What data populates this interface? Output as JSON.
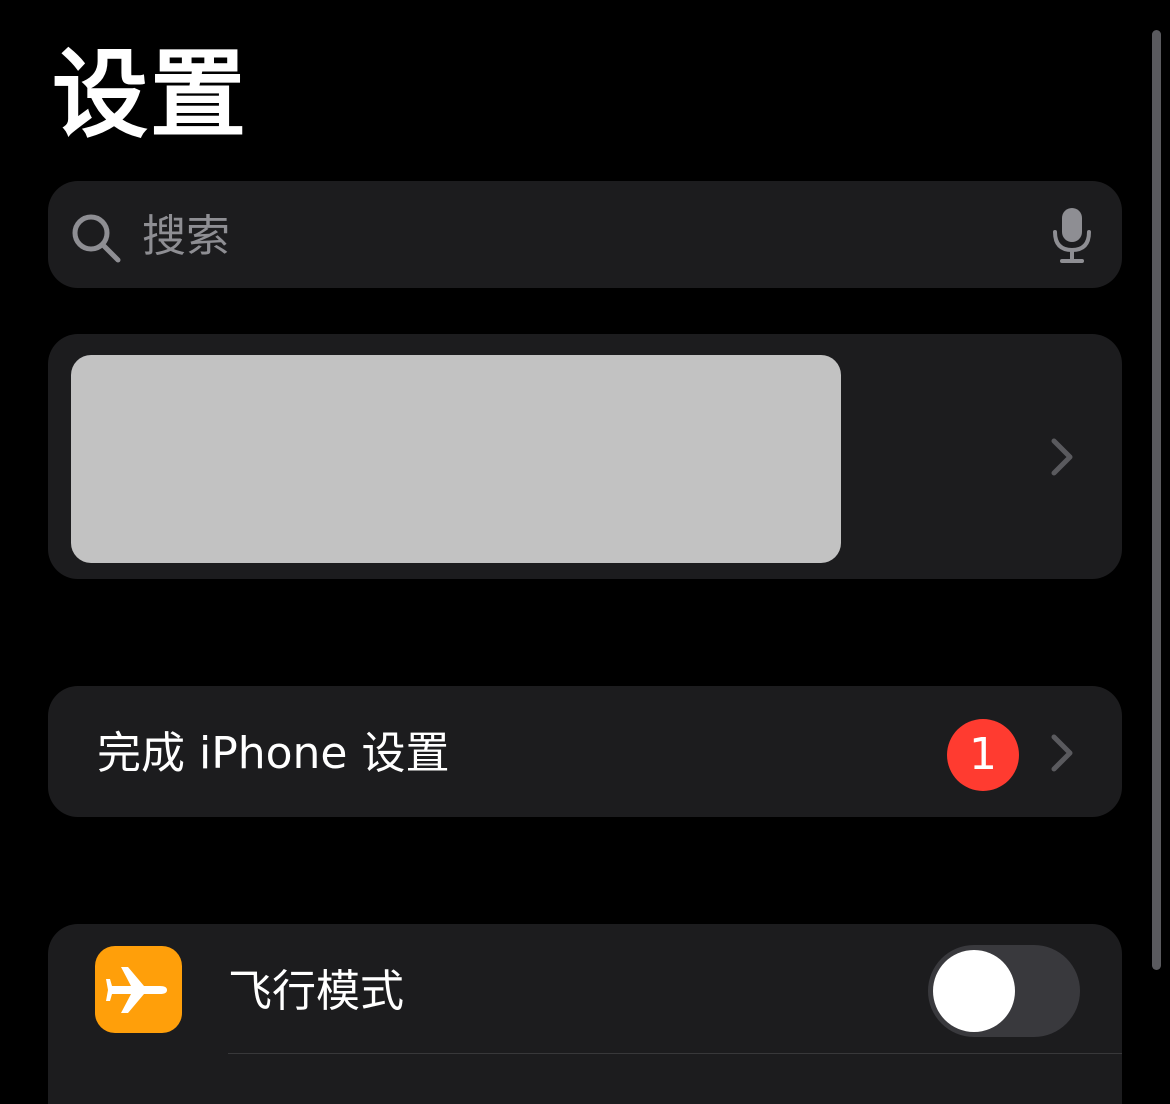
{
  "header": {
    "title": "设置"
  },
  "search": {
    "placeholder": "搜索",
    "search_icon": "magnifying-glass",
    "mic_icon": "microphone"
  },
  "account_card": {
    "chevron_icon": "chevron-right"
  },
  "setup_row": {
    "label": "完成 iPhone 设置",
    "badge_count": "1",
    "chevron_icon": "chevron-right"
  },
  "settings_rows": [
    {
      "label": "飞行模式",
      "icon": "airplane",
      "toggle_on": false
    }
  ],
  "colors": {
    "background": "#000000",
    "card": "#1c1c1e",
    "badge": "#ff3b30",
    "airplane_tile": "#ff9f0a",
    "toggle_off_track": "#39393d",
    "secondary_text": "#8e8e93"
  }
}
